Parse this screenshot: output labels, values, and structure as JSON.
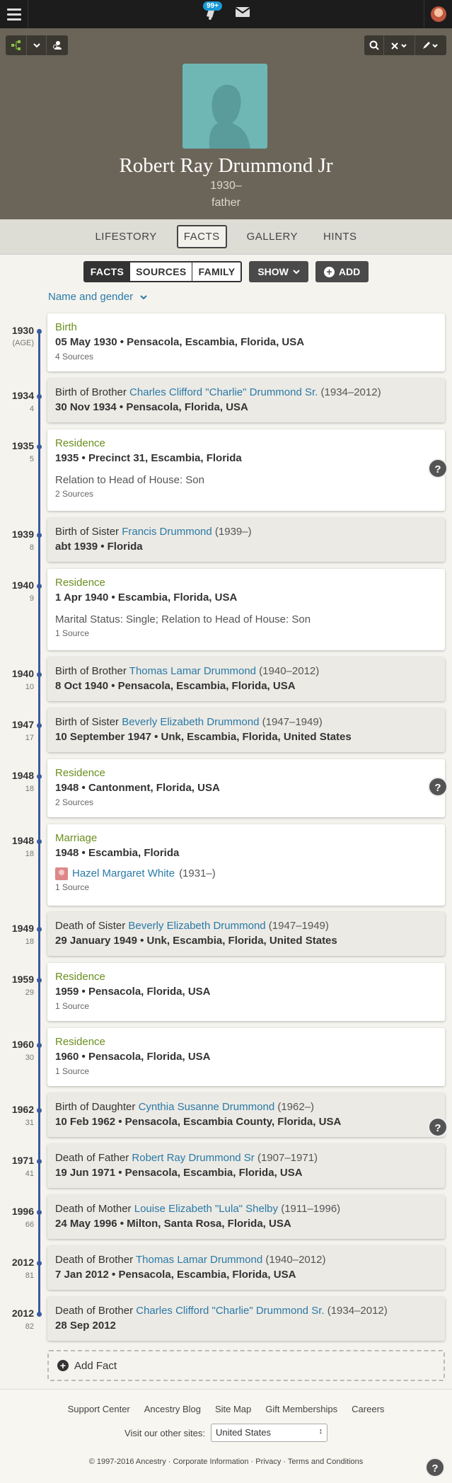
{
  "topbar": {
    "notifications_badge": "99+",
    "icons": [
      "menu-icon",
      "notifications-icon",
      "mail-icon",
      "profile-avatar"
    ]
  },
  "person": {
    "name": "Robert Ray Drummond Jr",
    "years": "1930–",
    "relationship": "father"
  },
  "tabs": [
    {
      "label": "LIFESTORY",
      "active": false
    },
    {
      "label": "FACTS",
      "active": true
    },
    {
      "label": "GALLERY",
      "active": false
    },
    {
      "label": "HINTS",
      "active": false
    }
  ],
  "subtoolbar": {
    "segments": [
      {
        "label": "FACTS",
        "active": true
      },
      {
        "label": "SOURCES",
        "active": false
      },
      {
        "label": "FAMILY",
        "active": false
      }
    ],
    "show_label": "SHOW",
    "add_label": "ADD"
  },
  "name_gender_label": "Name and gender",
  "events": [
    {
      "year": "1930",
      "age": "(AGE)",
      "title": "Birth",
      "detail": "05 May 1930 • Pensacola, Escambia, Florida, USA",
      "sources": "4 Sources"
    },
    {
      "year": "1934",
      "age": "4",
      "title_prefix": "Birth of Brother ",
      "link": "Charles Clifford \"Charlie\" Drummond Sr.",
      "dates": " (1934–2012)",
      "detail": "30 Nov 1934 • Pensacola, Florida, USA"
    },
    {
      "year": "1935",
      "age": "5",
      "title": "Residence",
      "detail": "1935 • Precinct 31, Escambia, Florida",
      "note": "Relation to Head of House: Son",
      "sources": "2 Sources"
    },
    {
      "year": "1939",
      "age": "8",
      "title_prefix": "Birth of Sister ",
      "link": "Francis Drummond",
      "dates": " (1939–)",
      "detail": "abt 1939 • Florida"
    },
    {
      "year": "1940",
      "age": "9",
      "title": "Residence",
      "detail": "1 Apr 1940 • Escambia, Florida, USA",
      "note": "Marital Status: Single; Relation to Head of House: Son",
      "sources": "1 Source"
    },
    {
      "year": "1940",
      "age": "10",
      "title_prefix": "Birth of Brother ",
      "link": "Thomas Lamar Drummond",
      "dates": " (1940–2012)",
      "detail": "8 Oct 1940 • Pensacola, Escambia, Florida, USA"
    },
    {
      "year": "1947",
      "age": "17",
      "title_prefix": "Birth of Sister ",
      "link": "Beverly Elizabeth Drummond",
      "dates": " (1947–1949)",
      "detail": "10 September 1947 • Unk, Escambia, Florida, United States"
    },
    {
      "year": "1948",
      "age": "18",
      "title": "Residence",
      "detail": "1948 • Cantonment, Florida, USA",
      "sources": "2 Sources"
    },
    {
      "year": "1948",
      "age": "18",
      "title": "Marriage",
      "detail": "1948 • Escambia, Florida",
      "spouse": "Hazel Margaret White",
      "spouse_dates": " (1931–)",
      "sources": "1 Source"
    },
    {
      "year": "1949",
      "age": "18",
      "title_prefix": "Death of Sister ",
      "link": "Beverly Elizabeth Drummond",
      "dates": " (1947–1949)",
      "detail": "29 January 1949 • Unk, Escambia, Florida, United States"
    },
    {
      "year": "1959",
      "age": "29",
      "title": "Residence",
      "detail": "1959 • Pensacola, Florida, USA",
      "sources": "1 Source"
    },
    {
      "year": "1960",
      "age": "30",
      "title": "Residence",
      "detail": "1960 • Pensacola, Florida, USA",
      "sources": "1 Source"
    },
    {
      "year": "1962",
      "age": "31",
      "title_prefix": "Birth of Daughter ",
      "link": "Cynthia Susanne Drummond",
      "dates": " (1962–)",
      "detail": "10 Feb 1962 • Pensacola, Escambia County, Florida, USA"
    },
    {
      "year": "1971",
      "age": "41",
      "title_prefix": "Death of Father ",
      "link": "Robert Ray Drummond Sr",
      "dates": " (1907–1971)",
      "detail": "19 Jun 1971 • Pensacola, Escambia, Florida, USA"
    },
    {
      "year": "1996",
      "age": "66",
      "title_prefix": "Death of Mother ",
      "link": "Louise Elizabeth \"Lula\" Shelby",
      "dates": " (1911–1996)",
      "detail": "24 May 1996 • Milton, Santa Rosa, Florida, USA"
    },
    {
      "year": "2012",
      "age": "81",
      "title_prefix": "Death of Brother ",
      "link": "Thomas Lamar Drummond",
      "dates": " (1940–2012)",
      "detail": "7 Jan 2012 • Pensacola, Escambia, Florida, USA"
    },
    {
      "year": "2012",
      "age": "82",
      "title_prefix": "Death of Brother ",
      "link": "Charles Clifford \"Charlie\" Drummond Sr.",
      "dates": " (1934–2012)",
      "detail": "28 Sep 2012"
    }
  ],
  "help_glyph": "?",
  "add_fact_label": "Add Fact",
  "footer": {
    "links": [
      "Support Center",
      "Ancestry Blog",
      "Site Map",
      "Gift Memberships",
      "Careers"
    ],
    "visit_label": "Visit our other sites:",
    "site_select_value": "United States",
    "legal": "© 1997-2016 Ancestry · Corporate Information · Privacy · Terms and Conditions"
  },
  "colors": {
    "fact_green": "#6a8e1d",
    "link_blue": "#2a7aa6",
    "timeline_blue": "#3a5aa0",
    "hero_bg": "#6b6559"
  }
}
